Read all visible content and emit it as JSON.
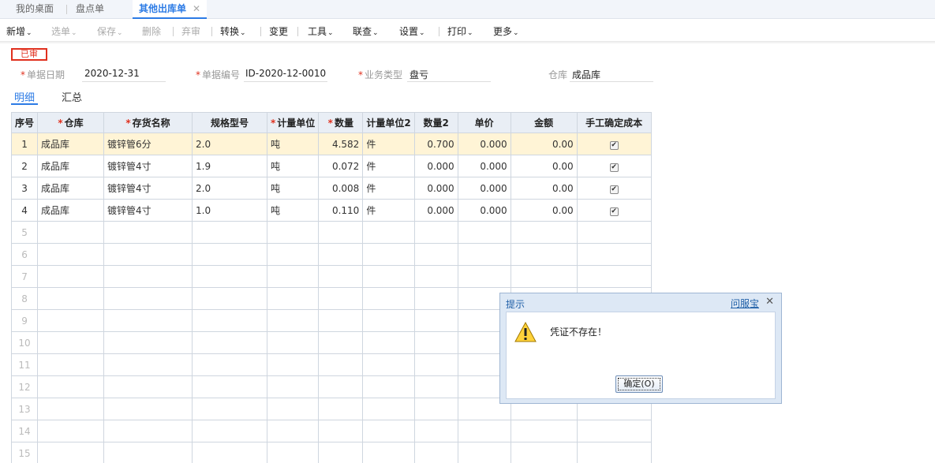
{
  "tabs": [
    {
      "label": "我的桌面"
    },
    {
      "label": "盘点单"
    },
    {
      "label": "其他出库单",
      "close": "✕"
    }
  ],
  "toolbar": {
    "new": "新增",
    "select": "选单",
    "save": "保存",
    "delete": "删除",
    "discard": "弃审",
    "convert": "转换",
    "change": "变更",
    "tools": "工具",
    "query": "联查",
    "settings": "设置",
    "print": "打印",
    "more": "更多",
    "caret": "⌄"
  },
  "status": {
    "label": "已审"
  },
  "form": {
    "date_label": "单据日期",
    "date_value": "2020-12-31",
    "code_label": "单据编号",
    "code_value": "ID-2020-12-0010",
    "type_label": "业务类型",
    "type_value": "盘亏",
    "warehouse_label": "仓库",
    "warehouse_value": "成品库"
  },
  "subtabs": [
    {
      "label": "明细"
    },
    {
      "label": "汇总"
    }
  ],
  "grid": {
    "headers": [
      "序号",
      "仓库",
      "存货名称",
      "规格型号",
      "计量单位",
      "数量",
      "计量单位2",
      "数量2",
      "单价",
      "金额",
      "手工确定成本"
    ],
    "rows": [
      [
        "1",
        "成品库",
        "镀锌管6分",
        "2.0",
        "吨",
        "4.582",
        "件",
        "0.700",
        "0.000",
        "0.00"
      ],
      [
        "2",
        "成品库",
        "镀锌管4寸",
        "1.9",
        "吨",
        "0.072",
        "件",
        "0.000",
        "0.000",
        "0.00"
      ],
      [
        "3",
        "成品库",
        "镀锌管4寸",
        "2.0",
        "吨",
        "0.008",
        "件",
        "0.000",
        "0.000",
        "0.00"
      ],
      [
        "4",
        "成品库",
        "镀锌管4寸",
        "1.0",
        "吨",
        "0.110",
        "件",
        "0.000",
        "0.000",
        "0.00"
      ]
    ],
    "empty_rows": [
      "5",
      "6",
      "7",
      "8",
      "9",
      "10",
      "11",
      "12",
      "13",
      "14",
      "15"
    ]
  },
  "dialog": {
    "title": "提示",
    "help": "问服宝",
    "close": "✕",
    "message": "凭证不存在！",
    "ok": "确定(O)"
  },
  "colors": {
    "accent": "#2c7be5",
    "stamp": "#e0301e",
    "selected_row": "#fff4d6"
  }
}
